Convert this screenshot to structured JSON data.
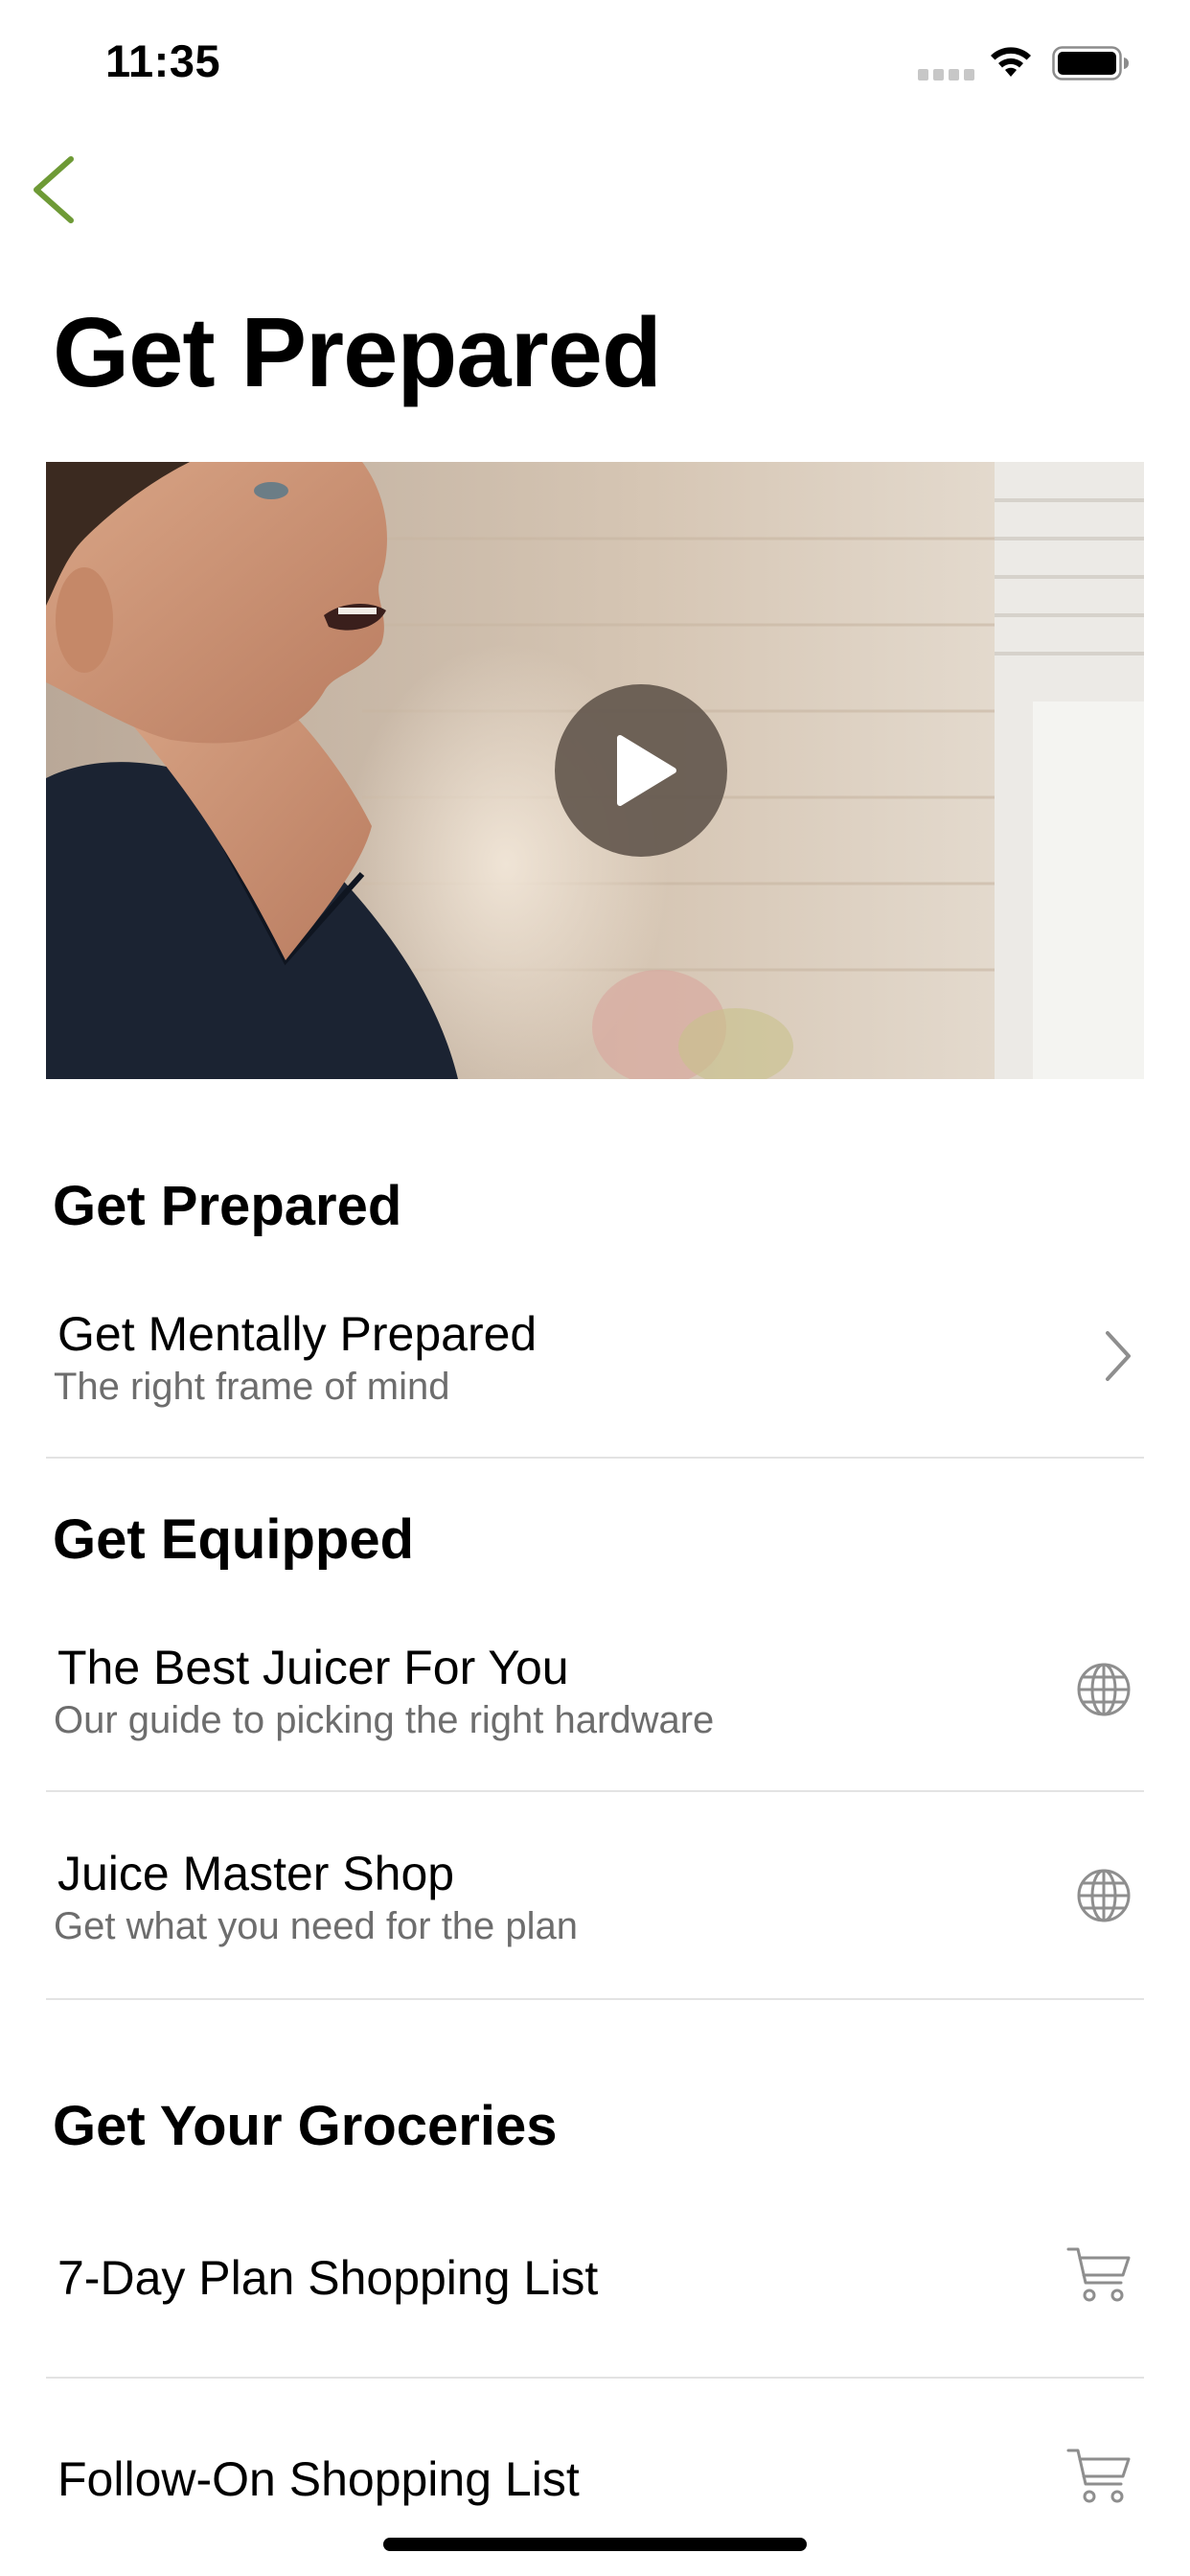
{
  "status_bar": {
    "time": "11:35"
  },
  "nav": {
    "back_icon": "chevron-left-icon",
    "accent_color": "#6e9a36"
  },
  "page": {
    "title": "Get Prepared"
  },
  "video": {
    "play_icon": "play-icon"
  },
  "sections": [
    {
      "title": "Get Prepared",
      "items": [
        {
          "title": "Get Mentally Prepared",
          "subtitle": "The right frame of mind",
          "icon": "chevron-right-icon"
        }
      ]
    },
    {
      "title": "Get Equipped",
      "items": [
        {
          "title": "The Best Juicer For You",
          "subtitle": "Our guide to picking the right hardware",
          "icon": "globe-icon"
        },
        {
          "title": "Juice Master Shop",
          "subtitle": "Get what you need for the plan",
          "icon": "globe-icon"
        }
      ]
    },
    {
      "title": "Get Your Groceries",
      "items": [
        {
          "title": "7-Day Plan Shopping List",
          "icon": "cart-icon"
        },
        {
          "title": "Follow-On Shopping List",
          "icon": "cart-icon"
        }
      ]
    }
  ]
}
